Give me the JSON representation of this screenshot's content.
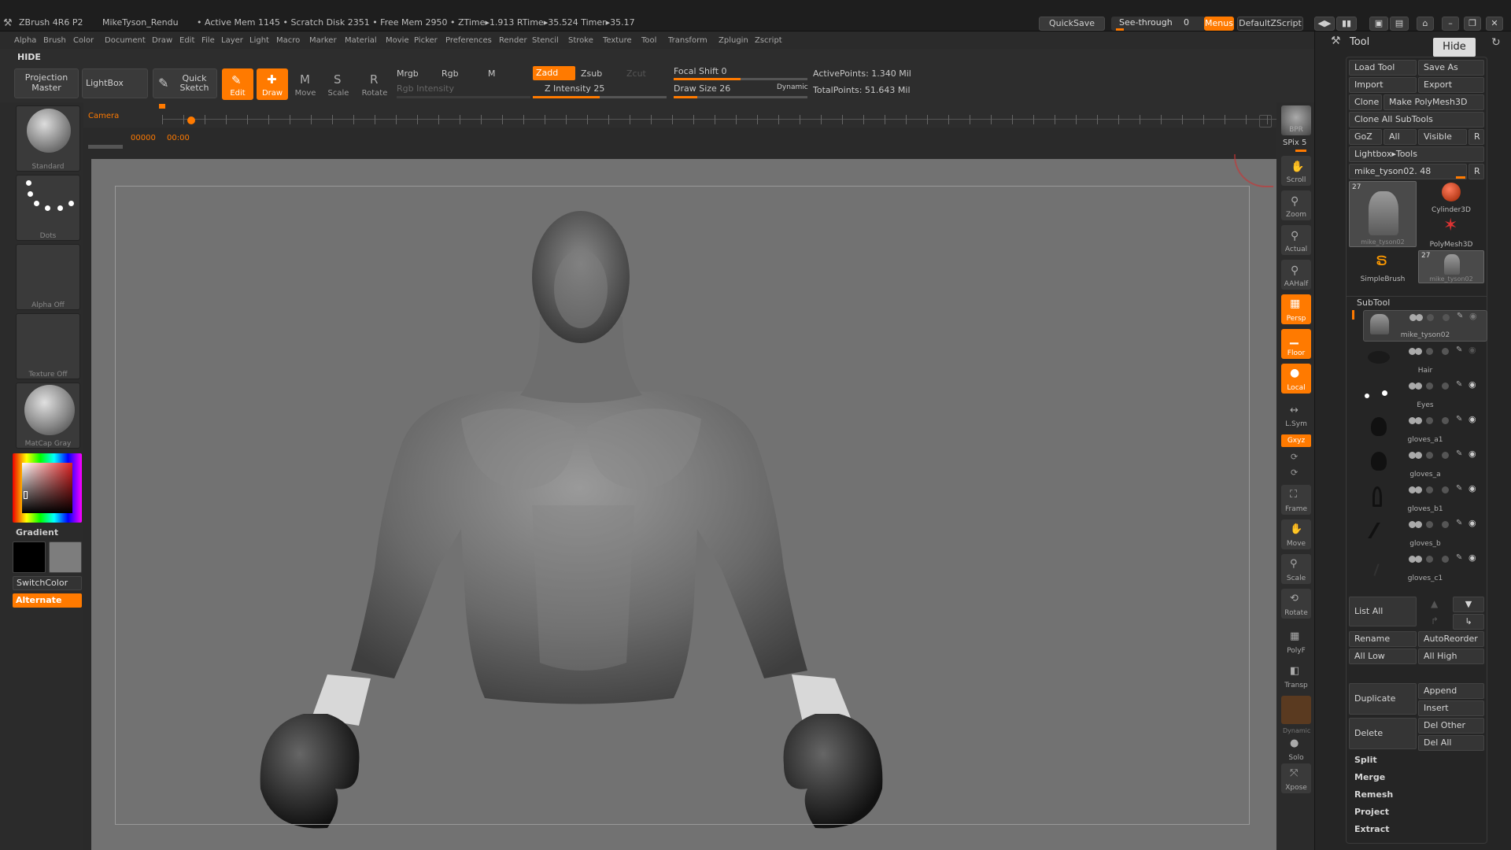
{
  "titlebar": {
    "app": "ZBrush 4R6 P2",
    "doc": "MikeTyson_Rendu",
    "stats": "• Active Mem 1145 • Scratch Disk 2351 • Free Mem 2950 • ZTime▸1.913 RTime▸35.524 Timer▸35.17",
    "quicksave": "QuickSave",
    "seethrough": "See-through",
    "seethrough_val": "0",
    "menus": "Menus",
    "script": "DefaultZScript"
  },
  "menus": [
    "Alpha",
    "Brush",
    "Color",
    "Document",
    "Draw",
    "Edit",
    "File",
    "Layer",
    "Light",
    "Macro",
    "Marker",
    "Material",
    "Movie",
    "Picker",
    "Preferences",
    "Render",
    "Stencil",
    "Stroke",
    "Texture",
    "Tool",
    "Transform",
    "Zplugin",
    "Zscript"
  ],
  "toolbar": {
    "hide": "HIDE",
    "projection_master": "Projection Master",
    "lightbox": "LightBox",
    "quick_sketch": "Quick Sketch",
    "edit": "Edit",
    "draw": "Draw",
    "move": "Move",
    "scale": "Scale",
    "rotate": "Rotate",
    "mrgb": "Mrgb",
    "rgb": "Rgb",
    "m": "M",
    "rgb_intensity": "Rgb Intensity",
    "zadd": "Zadd",
    "zsub": "Zsub",
    "zcut": "Zcut",
    "z_intensity": "Z Intensity 25",
    "z_intensity_value": 25,
    "focal_shift": "Focal Shift 0",
    "draw_size": "Draw Size 26",
    "draw_size_value": 26,
    "dynamic": "Dynamic",
    "active_points": "ActivePoints: 1.340 Mil",
    "total_points": "TotalPoints: 51.643 Mil"
  },
  "timeline": {
    "camera": "Camera",
    "counter": "00000",
    "time": "00:00"
  },
  "leftshelf": {
    "standard": "Standard",
    "dots": "Dots",
    "alpha_off": "Alpha Off",
    "texture_off": "Texture Off",
    "matcap_gray": "MatCap Gray",
    "gradient": "Gradient",
    "switchcolor": "SwitchColor",
    "alternate": "Alternate"
  },
  "rightshelf": {
    "bpr": "BPR",
    "spix": "SPix 5",
    "scroll": "Scroll",
    "zoom": "Zoom",
    "actual": "Actual",
    "aahalf": "AAHalf",
    "persp": "Persp",
    "floor": "Floor",
    "local": "Local",
    "lsym": "L.Sym",
    "xyz": "Gxyz",
    "frame": "Frame",
    "move": "Move",
    "scale": "Scale",
    "rotate": "Rotate",
    "polyf": "PolyF",
    "transp": "Transp",
    "dynamic": "Dynamic",
    "solo": "Solo",
    "xpose": "Xpose"
  },
  "toolpanel": {
    "title": "Tool",
    "hide_tip": "Hide",
    "load_tool": "Load Tool",
    "save_as": "Save As",
    "import": "Import",
    "export": "Export",
    "clone": "Clone",
    "make_polymesh": "Make PolyMesh3D",
    "clone_all": "Clone All SubTools",
    "goz": "GoZ",
    "all": "All",
    "visible": "Visible",
    "r": "R",
    "lightbox_tools": "Lightbox▸Tools",
    "current_tool": "mike_tyson02. 48",
    "tools": [
      {
        "name": "mike_tyson02",
        "count": "27"
      },
      {
        "name": "Cylinder3D"
      },
      {
        "name": "PolyMesh3D"
      },
      {
        "name": "SimpleBrush"
      },
      {
        "name": "mike_tyson02",
        "count": "27"
      }
    ],
    "subtool_header": "SubTool",
    "subtools": [
      "mike_tyson02",
      "Hair",
      "Eyes",
      "gloves_a1",
      "gloves_a",
      "gloves_b1",
      "gloves_b",
      "gloves_c1"
    ],
    "list_all": "List All",
    "rename": "Rename",
    "autoreorder": "AutoReorder",
    "all_low": "All Low",
    "all_high": "All High",
    "duplicate": "Duplicate",
    "append": "Append",
    "insert": "Insert",
    "delete": "Delete",
    "del_other": "Del Other",
    "del_all": "Del All",
    "split": "Split",
    "merge": "Merge",
    "remesh": "Remesh",
    "project": "Project",
    "extract": "Extract"
  },
  "colors": {
    "accent": "#ff7a00",
    "viewport": "#727272",
    "panel": "#252525"
  }
}
